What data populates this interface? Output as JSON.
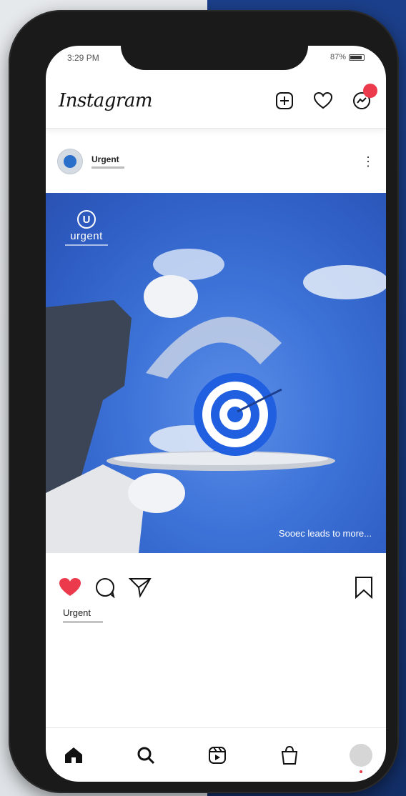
{
  "status_bar": {
    "time": "3:29 PM",
    "battery": "87%"
  },
  "header": {
    "logo": "Instagram",
    "icons": [
      "new-post-icon",
      "heart-icon",
      "messenger-icon"
    ]
  },
  "post": {
    "username": "Urgent",
    "brand_word": "urgent",
    "brand_letter": "U",
    "image_caption": "Sooec leads to more...",
    "liked_by": "Urgent",
    "like_color": "#ea3a4b"
  },
  "bottom_nav": [
    "home-icon",
    "search-icon",
    "reels-icon",
    "shop-icon",
    "profile-avatar"
  ]
}
